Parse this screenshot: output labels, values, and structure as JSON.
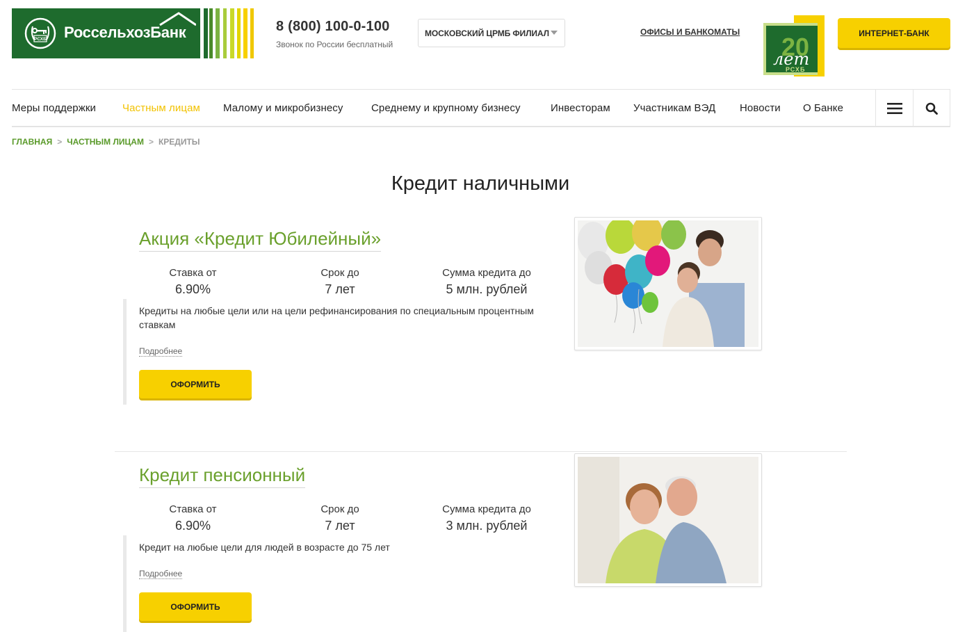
{
  "header": {
    "logo_text": "РоссельхозБанк",
    "logo_abbr": "РСХБ",
    "phone": "8 (800) 100-0-100",
    "phone_note": "Звонок по России бесплатный",
    "region": "МОСКОВСКИЙ ЦРМБ ФИЛИАЛ",
    "offices_link": "ОФИСЫ И БАНКОМАТЫ",
    "badge_number": "20",
    "badge_word": "лет",
    "badge_abbr": "РСХБ",
    "internet_bank": "ИНТЕРНЕТ-БАНК",
    "colors": {
      "brand_green": "#1e6b2d",
      "accent_yellow": "#f7d000",
      "link_green": "#6aa02c"
    }
  },
  "nav": {
    "items": [
      {
        "label": "Меры поддержки",
        "active": false
      },
      {
        "label": "Частным лицам",
        "active": true
      },
      {
        "label": "Малому и микробизнесу",
        "active": false
      },
      {
        "label": "Среднему и крупному бизнесу",
        "active": false
      },
      {
        "label": "Инвесторам",
        "active": false
      },
      {
        "label": "Участникам ВЭД",
        "active": false
      },
      {
        "label": "Новости",
        "active": false
      },
      {
        "label": "О Банке",
        "active": false
      }
    ],
    "menu_icon": "hamburger-icon",
    "search_icon": "search-icon"
  },
  "breadcrumb": {
    "items": [
      "ГЛАВНАЯ",
      "ЧАСТНЫМ ЛИЦАМ"
    ],
    "separator": ">",
    "current": "КРЕДИТЫ"
  },
  "page": {
    "title": "Кредит наличными"
  },
  "products": [
    {
      "title": "Акция «Кредит Юбилейный»",
      "stats": [
        {
          "label": "Ставка от",
          "value": "6.90%"
        },
        {
          "label": "Срок до",
          "value": "7 лет"
        },
        {
          "label": "Сумма кредита до",
          "value": "5 млн. рублей"
        }
      ],
      "description": "Кредиты на любые цели или на цели рефинансирования по специальным процентным ставкам",
      "more": "Подробнее",
      "apply": "ОФОРМИТЬ"
    },
    {
      "title": "Кредит пенсионный",
      "stats": [
        {
          "label": "Ставка от",
          "value": "6.90%"
        },
        {
          "label": "Срок до",
          "value": "7 лет"
        },
        {
          "label": "Сумма кредита до",
          "value": "3 млн. рублей"
        }
      ],
      "description": "Кредит на любые цели для людей в возрасте до 75 лет",
      "more": "Подробнее",
      "apply": "ОФОРМИТЬ"
    }
  ]
}
